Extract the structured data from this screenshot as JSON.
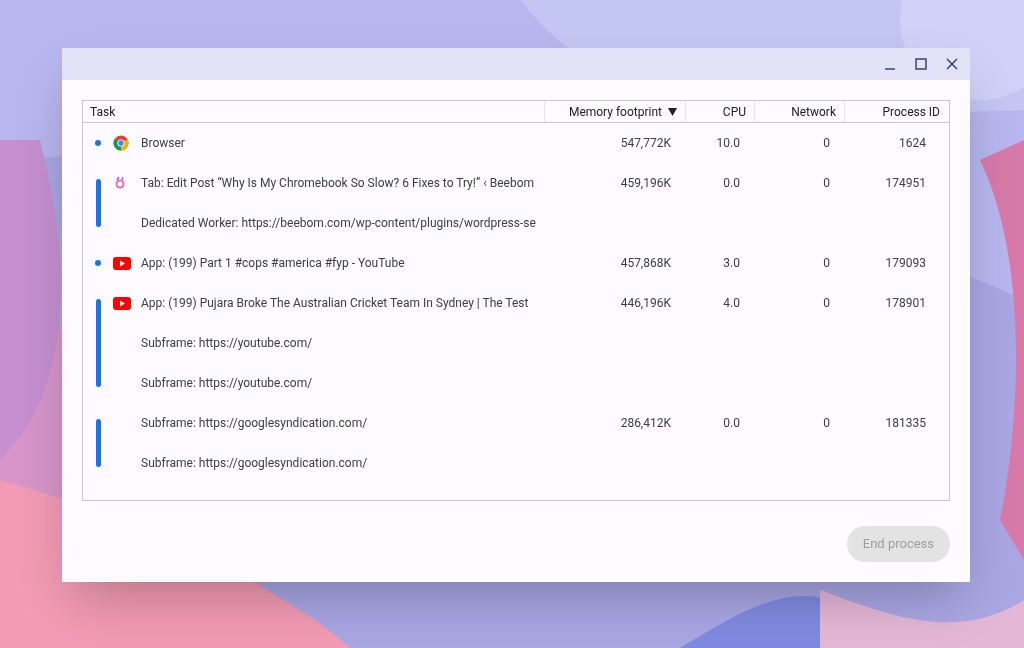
{
  "table": {
    "columns": [
      {
        "label": "Task",
        "sorted": false
      },
      {
        "label": "Memory footprint",
        "sorted": true
      },
      {
        "label": "CPU",
        "sorted": false
      },
      {
        "label": "Network",
        "sorted": false
      },
      {
        "label": "Process ID",
        "sorted": false
      }
    ],
    "groups": [
      {
        "kind": "chrome",
        "rows": [
          {
            "task": "Browser",
            "memory": "547,772K",
            "cpu": "10.0",
            "network": "0",
            "pid": "1624"
          }
        ]
      },
      {
        "kind": "tab",
        "rows": [
          {
            "task": "Tab: Edit Post “Why Is My Chromebook So Slow? 6 Fixes to Try!” ‹ Beebom",
            "memory": "459,196K",
            "cpu": "0.0",
            "network": "0",
            "pid": "174951"
          },
          {
            "task": "Dedicated Worker: https://beebom.com/wp-content/plugins/wordpress-se"
          }
        ]
      },
      {
        "kind": "app",
        "rows": [
          {
            "task": "App: (199) Part 1 #cops #america #fyp - YouTube",
            "memory": "457,868K",
            "cpu": "3.0",
            "network": "0",
            "pid": "179093"
          }
        ]
      },
      {
        "kind": "app",
        "rows": [
          {
            "task": "App: (199) Pujara Broke The Australian Cricket Team In Sydney | The Test",
            "memory": "446,196K",
            "cpu": "4.0",
            "network": "0",
            "pid": "178901"
          },
          {
            "task": "Subframe: https://youtube.com/"
          },
          {
            "task": "Subframe: https://youtube.com/"
          }
        ]
      },
      {
        "kind": "subframe",
        "rows": [
          {
            "task": "Subframe: https://googlesyndication.com/",
            "memory": "286,412K",
            "cpu": "0.0",
            "network": "0",
            "pid": "181335"
          },
          {
            "task": "Subframe: https://googlesyndication.com/"
          }
        ]
      }
    ]
  },
  "end_button": {
    "label": "End process",
    "disabled": true
  }
}
